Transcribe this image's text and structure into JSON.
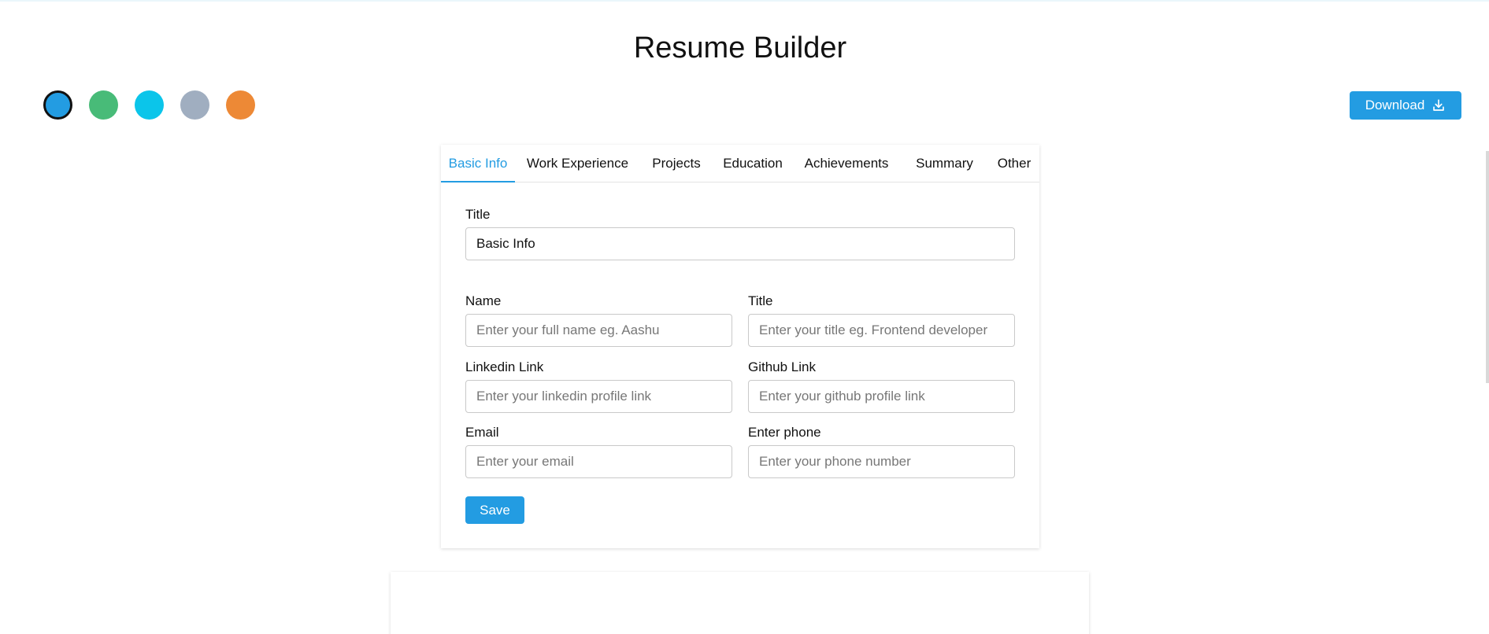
{
  "app": {
    "title": "Resume Builder"
  },
  "color_palette": {
    "swatches": [
      {
        "name": "blue",
        "color": "#239ce2",
        "selected": true
      },
      {
        "name": "green",
        "color": "#48bb78"
      },
      {
        "name": "cyan",
        "color": "#0bc5ea"
      },
      {
        "name": "gray",
        "color": "#a0aec0"
      },
      {
        "name": "orange",
        "color": "#ed8936"
      }
    ]
  },
  "toolbar": {
    "download_label": "Download"
  },
  "tabs": [
    {
      "label": "Basic Info",
      "active": true
    },
    {
      "label": "Work Experience"
    },
    {
      "label": "Projects"
    },
    {
      "label": "Education"
    },
    {
      "label": "Achievements"
    },
    {
      "label": "Summary"
    },
    {
      "label": "Other"
    }
  ],
  "form": {
    "section_title": {
      "label": "Title",
      "value": "Basic Info"
    },
    "name": {
      "label": "Name",
      "placeholder": "Enter your full name eg. Aashu"
    },
    "title": {
      "label": "Title",
      "placeholder": "Enter your title eg. Frontend developer"
    },
    "linkedin": {
      "label": "Linkedin Link",
      "placeholder": "Enter your linkedin profile link"
    },
    "github": {
      "label": "Github Link",
      "placeholder": "Enter your github profile link"
    },
    "email": {
      "label": "Email",
      "placeholder": "Enter your email"
    },
    "phone": {
      "label": "Enter phone",
      "placeholder": "Enter your phone number"
    },
    "save_label": "Save"
  },
  "colors": {
    "accent": "#239ce2"
  }
}
